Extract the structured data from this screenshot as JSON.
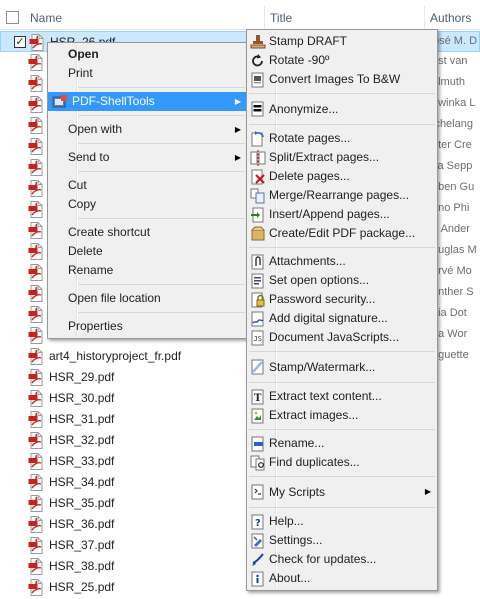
{
  "header": {
    "name_label": "Name",
    "title_label": "Title",
    "authors_label": "Authors"
  },
  "files": [
    {
      "name": "HSR_26.pdf",
      "author": "osé M. D",
      "selected": true,
      "checked": true
    },
    {
      "name": "",
      "author": "ost van"
    },
    {
      "name": "",
      "author": "elmuth"
    },
    {
      "name": "",
      "author": "ewinka L"
    },
    {
      "name": "",
      "author": "ichelang"
    },
    {
      "name": "",
      "author": "eter Cre"
    },
    {
      "name": "",
      "author": "ka Sepp"
    },
    {
      "name": "",
      "author": "eben Gu"
    },
    {
      "name": "",
      "author": "uno Phi"
    },
    {
      "name": "",
      "author": "e Ander"
    },
    {
      "name": "",
      "author": "ouglas M"
    },
    {
      "name": "",
      "author": "ervé Mo"
    },
    {
      "name": "",
      "author": "ünther S"
    },
    {
      "name": "",
      "author": "dia Dot"
    },
    {
      "name": "",
      "author": "na Wor"
    },
    {
      "name": "art4_historyproject_fr.pdf",
      "author": "uguette"
    },
    {
      "name": "HSR_29.pdf",
      "author": ""
    },
    {
      "name": "HSR_30.pdf",
      "author": ""
    },
    {
      "name": "HSR_31.pdf",
      "author": ""
    },
    {
      "name": "HSR_32.pdf",
      "author": ""
    },
    {
      "name": "HSR_33.pdf",
      "author": ""
    },
    {
      "name": "HSR_34.pdf",
      "author": ""
    },
    {
      "name": "HSR_35.pdf",
      "author": ""
    },
    {
      "name": "HSR_36.pdf",
      "author": ""
    },
    {
      "name": "HSR_37.pdf",
      "author": ""
    },
    {
      "name": "HSR_38.pdf",
      "author": ""
    },
    {
      "name": "HSR_25.pdf",
      "author": ""
    }
  ],
  "context_menu": {
    "items": [
      {
        "label": "Open",
        "bold": true
      },
      {
        "label": "Print"
      },
      {
        "separator": true
      },
      {
        "label": "PDF-ShellTools",
        "submenu": true,
        "highlight": true,
        "icon": "pdf-shelltools-icon"
      },
      {
        "separator": true
      },
      {
        "label": "Open with",
        "submenu": true
      },
      {
        "separator": true
      },
      {
        "label": "Send to",
        "submenu": true
      },
      {
        "separator": true
      },
      {
        "label": "Cut"
      },
      {
        "label": "Copy"
      },
      {
        "separator": true
      },
      {
        "label": "Create shortcut"
      },
      {
        "label": "Delete"
      },
      {
        "label": "Rename"
      },
      {
        "separator": true
      },
      {
        "label": "Open file location"
      },
      {
        "separator": true
      },
      {
        "label": "Properties"
      }
    ]
  },
  "submenu": {
    "items": [
      {
        "label": "Stamp DRAFT",
        "icon": "stamp-icon"
      },
      {
        "label": "Rotate -90º",
        "icon": "rotate-icon"
      },
      {
        "label": "Convert Images To B&W",
        "icon": "bw-convert-icon"
      },
      {
        "separator": true
      },
      {
        "label": "Anonymize...",
        "icon": "anonymize-icon",
        "tall": true
      },
      {
        "separator": true
      },
      {
        "label": "Rotate pages...",
        "icon": "rotate-pages-icon"
      },
      {
        "label": "Split/Extract pages...",
        "icon": "split-icon"
      },
      {
        "label": "Delete pages...",
        "icon": "delete-pages-icon"
      },
      {
        "label": "Merge/Rearrange pages...",
        "icon": "merge-icon"
      },
      {
        "label": "Insert/Append pages...",
        "icon": "insert-icon"
      },
      {
        "label": "Create/Edit PDF package...",
        "icon": "package-icon"
      },
      {
        "separator": true
      },
      {
        "label": "Attachments...",
        "icon": "attachment-icon"
      },
      {
        "label": "Set open options...",
        "icon": "open-options-icon"
      },
      {
        "label": "Password security...",
        "icon": "lock-icon"
      },
      {
        "label": "Add digital signature...",
        "icon": "signature-icon"
      },
      {
        "label": "Document JavaScripts...",
        "icon": "script-icon"
      },
      {
        "separator": true
      },
      {
        "label": "Stamp/Watermark...",
        "icon": "watermark-icon",
        "tall": true
      },
      {
        "separator": true
      },
      {
        "label": "Extract text content...",
        "icon": "extract-text-icon"
      },
      {
        "label": "Extract images...",
        "icon": "extract-images-icon"
      },
      {
        "separator": true
      },
      {
        "label": "Rename...",
        "icon": "rename-icon"
      },
      {
        "label": "Find duplicates...",
        "icon": "duplicates-icon"
      },
      {
        "separator": true
      },
      {
        "label": "My Scripts",
        "icon": "my-scripts-icon",
        "submenu": true,
        "tall": true
      },
      {
        "separator": true
      },
      {
        "label": "Help...",
        "icon": "help-icon"
      },
      {
        "label": "Settings...",
        "icon": "settings-icon"
      },
      {
        "label": "Check for updates...",
        "icon": "updates-icon"
      },
      {
        "label": "About...",
        "icon": "about-icon"
      }
    ]
  }
}
